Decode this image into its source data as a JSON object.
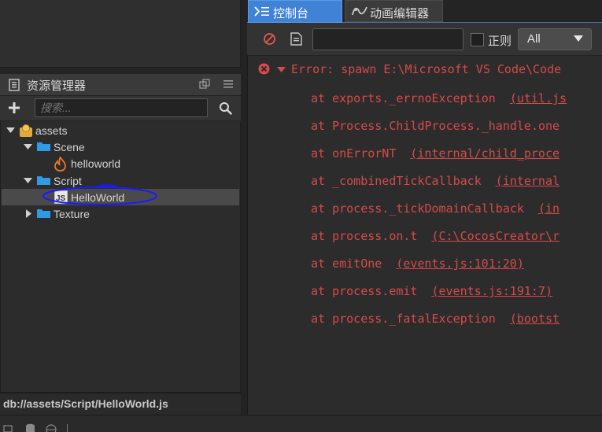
{
  "assets_panel": {
    "title": "资源管理器",
    "search_placeholder": "搜索...",
    "tree": [
      {
        "label": "assets",
        "icon": "assets-db-icon"
      },
      {
        "label": "Scene",
        "icon": "folder-icon"
      },
      {
        "label": "helloworld",
        "icon": "scene-fire-icon"
      },
      {
        "label": "Script",
        "icon": "folder-icon"
      },
      {
        "label": "HelloWorld",
        "icon": "js-file-icon"
      },
      {
        "label": "Texture",
        "icon": "folder-icon"
      }
    ],
    "status_path": "db://assets/Script/HelloWorld.js"
  },
  "console": {
    "tabs": [
      {
        "label": "控制台",
        "icon": "console-icon",
        "active": true
      },
      {
        "label": "动画编辑器",
        "icon": "animation-icon",
        "active": false
      }
    ],
    "regex_label": "正则",
    "level_value": "All",
    "error_head": "Error: spawn E:\\Microsoft VS Code\\Code",
    "stack": [
      {
        "text": "at exports._errnoException",
        "link": "(util.js"
      },
      {
        "text": "at Process.ChildProcess._handle.one",
        "link": ""
      },
      {
        "text": "at onErrorNT",
        "link": "(internal/child_proce"
      },
      {
        "text": "at _combinedTickCallback",
        "link": "(internal"
      },
      {
        "text": "at process._tickDomainCallback",
        "link": "(in"
      },
      {
        "text": "at process.on.t",
        "link": "(C:\\CocosCreator\\r"
      },
      {
        "text": "at emitOne",
        "link": "(events.js:101:20)"
      },
      {
        "text": "at process.emit",
        "link": "(events.js:191:7)"
      },
      {
        "text": "at process._fatalException",
        "link": "(bootst"
      }
    ]
  },
  "colors": {
    "accent_tab": "#3f82d6",
    "error_text": "#d64a4a",
    "folder": "#2f9be6",
    "annotation_ellipse": "#1a1aff"
  }
}
